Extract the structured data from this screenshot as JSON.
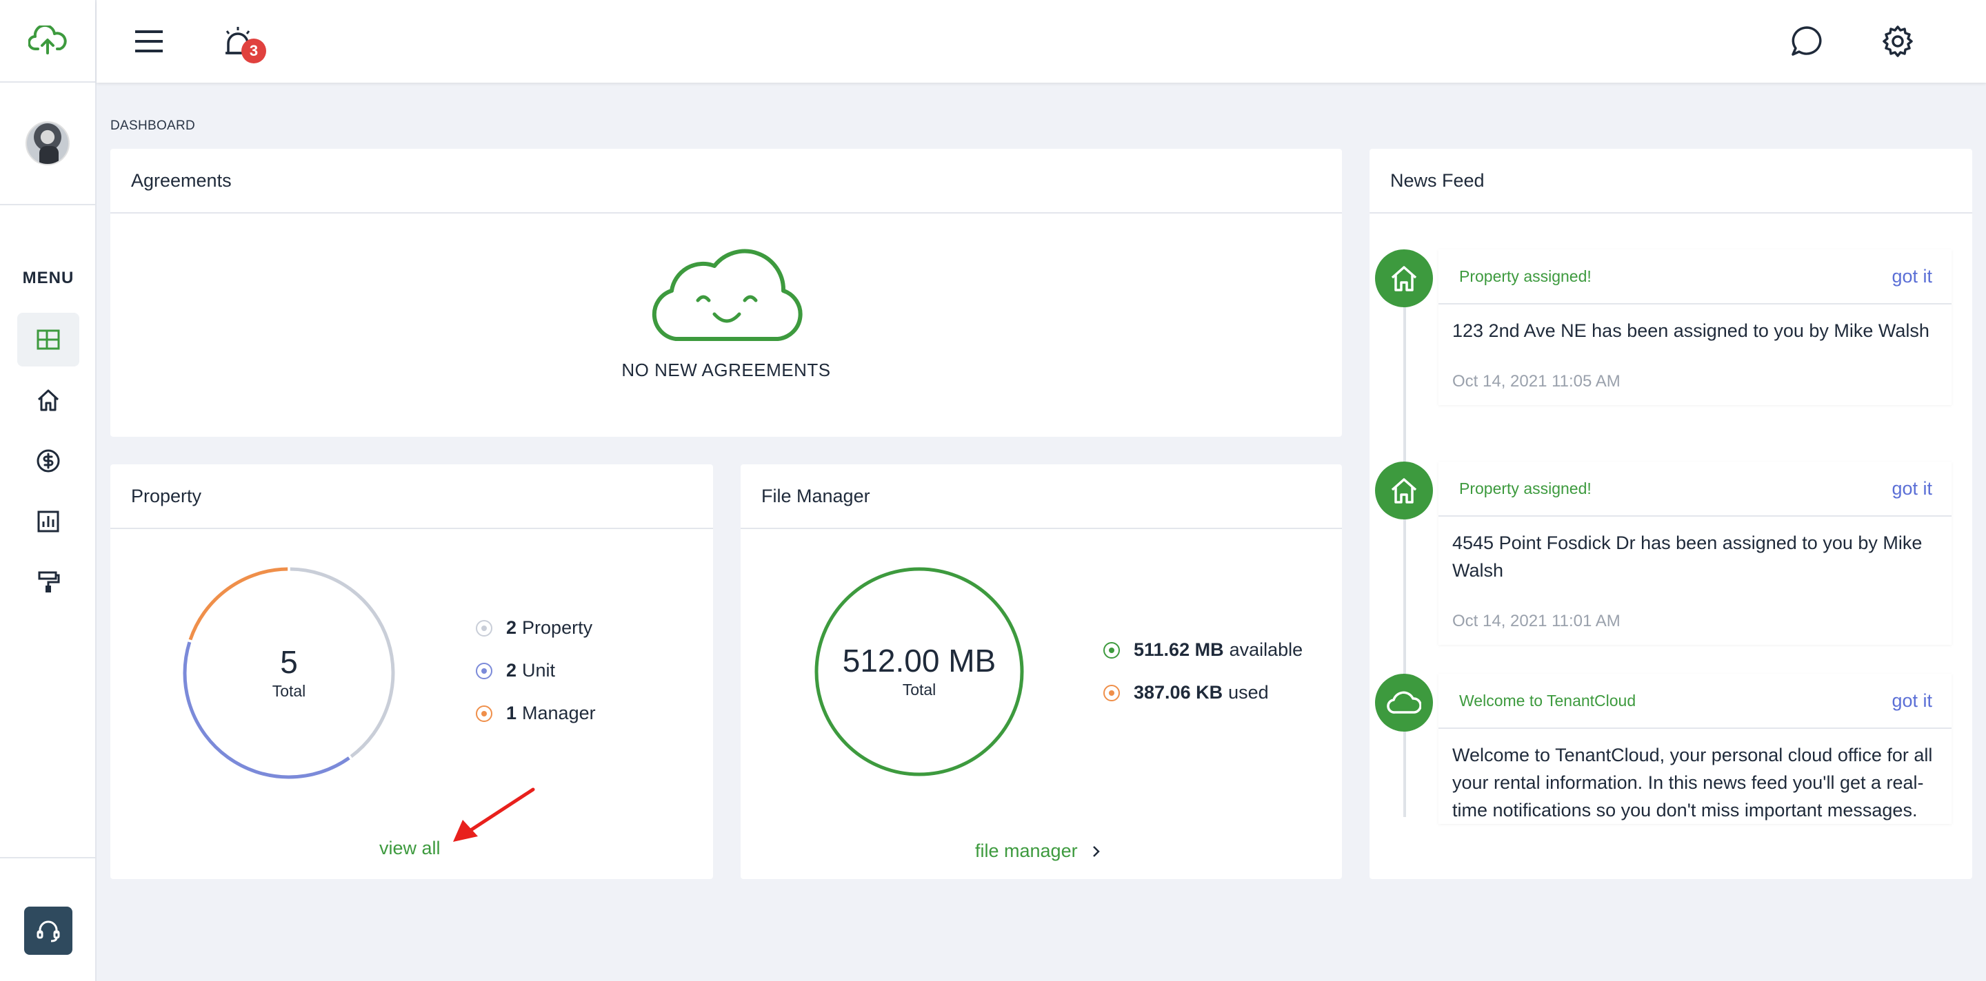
{
  "header": {
    "notification_count": "3"
  },
  "sidebar": {
    "menu_label": "MENU",
    "items": [
      {
        "name": "dashboard",
        "icon": "dashboard-icon",
        "active": true
      },
      {
        "name": "properties",
        "icon": "home-icon"
      },
      {
        "name": "payments",
        "icon": "dollar-icon"
      },
      {
        "name": "reports",
        "icon": "bar-chart-icon"
      },
      {
        "name": "maintenance",
        "icon": "paint-roller-icon"
      }
    ]
  },
  "breadcrumb": "DASHBOARD",
  "agreements": {
    "title": "Agreements",
    "empty_text": "NO NEW AGREEMENTS"
  },
  "property": {
    "title": "Property",
    "total_value": "5",
    "total_label": "Total",
    "legend": [
      {
        "count": "2",
        "label": "Property",
        "color": "#c9ced8",
        "value": 2
      },
      {
        "count": "2",
        "label": "Unit",
        "color": "#7b8ad9",
        "value": 2
      },
      {
        "count": "1",
        "label": "Manager",
        "color": "#ef8f4a",
        "value": 1
      }
    ],
    "view_all": "view all"
  },
  "file_manager": {
    "title": "File Manager",
    "total_value": "512.00 MB",
    "total_label": "Total",
    "available_value": "511.62 MB",
    "available_label": "available",
    "used_value": "387.06 KB",
    "used_label": "used",
    "link": "file manager"
  },
  "news_feed": {
    "title": "News Feed",
    "items": [
      {
        "icon": "home-icon",
        "title": "Property assigned!",
        "action": "got it",
        "body": "123 2nd Ave NE has been assigned to you by Mike Walsh",
        "date": "Oct 14, 2021 11:05 AM"
      },
      {
        "icon": "home-icon",
        "title": "Property assigned!",
        "action": "got it",
        "body": "4545 Point Fosdick Dr has been assigned to you by Mike Walsh",
        "date": "Oct 14, 2021 11:01 AM"
      },
      {
        "icon": "cloud-icon",
        "title": "Welcome to TenantCloud",
        "action": "got it",
        "body": "Welcome to TenantCloud, your personal cloud office for all your rental information. In this news feed you'll get a real-time notifications so you don't miss important messages.",
        "date": ""
      }
    ]
  },
  "colors": {
    "accent_green": "#3d9a3e",
    "link_blue": "#5b6fd6",
    "badge_red": "#e0413e",
    "support_dark": "#2f4a5e"
  }
}
